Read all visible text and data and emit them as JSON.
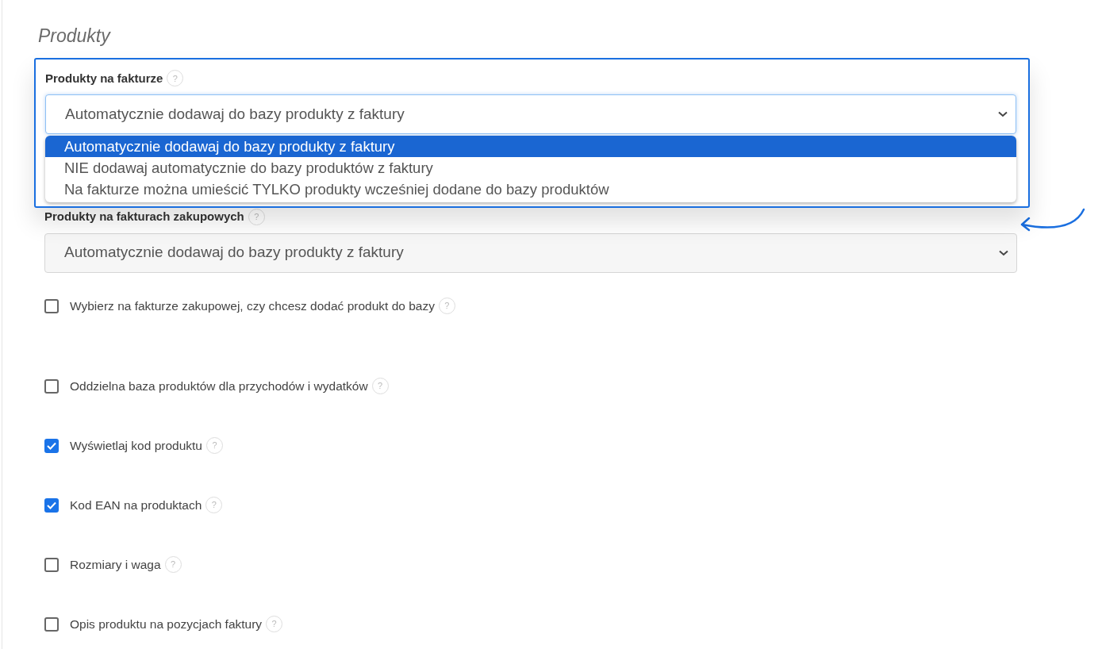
{
  "heading": "Produkty",
  "fields": [
    {
      "label": "Produkty na fakturze",
      "help": "?",
      "value": "Automatycznie dodawaj do bazy produkty z faktury",
      "expanded": true,
      "options": [
        {
          "label": "Automatycznie dodawaj do bazy produkty z faktury",
          "selected": true
        },
        {
          "label": "NIE dodawaj automatycznie do bazy produktów z faktury",
          "selected": false
        },
        {
          "label": "Na fakturze można umieścić TYLKO produkty wcześniej dodane do bazy produktów",
          "selected": false
        }
      ]
    },
    {
      "label": "Produkty na fakturach zakupowych",
      "help": "?",
      "value": "Automatycznie dodawaj do bazy produkty z faktury",
      "expanded": false
    }
  ],
  "checkboxes": [
    {
      "label": "Wybierz na fakturze zakupowej, czy chcesz dodać produkt do bazy",
      "help": "?",
      "checked": false
    },
    {
      "label": "Oddzielna baza produktów dla przychodów i wydatków",
      "help": "?",
      "checked": false
    },
    {
      "label": "Wyświetlaj kod produktu",
      "help": "?",
      "checked": true
    },
    {
      "label": "Kod EAN na produktach",
      "help": "?",
      "checked": true
    },
    {
      "label": "Rozmiary i waga",
      "help": "?",
      "checked": false
    },
    {
      "label": "Opis produktu na pozycjach faktury",
      "help": "?",
      "checked": false
    }
  ]
}
